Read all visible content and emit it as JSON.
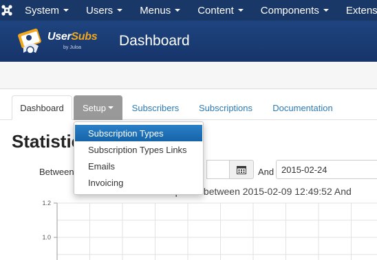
{
  "topbar": {
    "menu": [
      "System",
      "Users",
      "Menus",
      "Content",
      "Components",
      "Extensio"
    ]
  },
  "header": {
    "logo_brand_a": "User",
    "logo_brand_b": "Subs",
    "logo_by": "by Juloa",
    "title": "Dashboard"
  },
  "tabs": {
    "dashboard": "Dashboard",
    "setup": "Setup",
    "subscribers": "Subscribers",
    "subscriptions": "Subscriptions",
    "documentation": "Documentation"
  },
  "setup_menu": {
    "items": [
      "Subscription Types",
      "Subscription Types Links",
      "Emails",
      "Invoicing"
    ],
    "highlighted": "Subscription Types"
  },
  "page": {
    "heading": "Statistic",
    "between_label": "Between",
    "and_label": "And",
    "date_to": "2015-02-24"
  },
  "chart_data": {
    "type": "line",
    "title": "Subscriptions between 2015-02-09 12:49:52 And",
    "yticks": [
      "1.2",
      "1.0"
    ],
    "grid": true,
    "series": []
  },
  "colors": {
    "topbar": "#1a3867",
    "header": "#1c3d75",
    "accent": "#2a7ab5",
    "active_tab": "#999999",
    "dropdown_highlight": "#1d6fb8"
  }
}
